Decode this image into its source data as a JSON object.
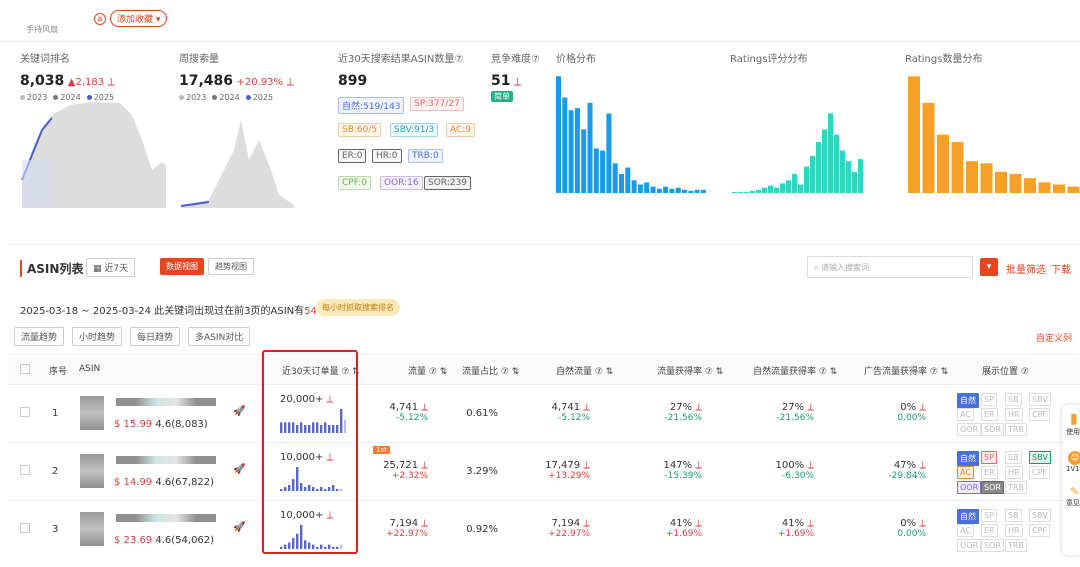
{
  "header": {
    "subtitle": "手持风扇",
    "fav_label": "添加收藏 ▾"
  },
  "metrics": {
    "kw_rank": {
      "title": "关键词排名",
      "value": "8,038",
      "delta": "▲2,183"
    },
    "weekly": {
      "title": "周搜索量",
      "value": "17,486",
      "delta": "+20.93%"
    },
    "asin30": {
      "title": "近30天搜索结果ASIN数量⑦",
      "value": "899"
    },
    "comp": {
      "title": "竞争难度⑦",
      "value": "51",
      "badge": "简单"
    },
    "price": {
      "title": "价格分布"
    },
    "rating": {
      "title": "Ratings评分分布"
    },
    "rcount": {
      "title": "Ratings数量分布"
    },
    "years": [
      "2023",
      "2024",
      "2025"
    ]
  },
  "asin_tags": [
    {
      "t": "自然:519/143",
      "c": "#4a6fd8",
      "bg": "#eef2ff"
    },
    {
      "t": "SP:377/27",
      "c": "#e26a6a",
      "bg": "#fff2f2"
    },
    {
      "t": "SB:60/5",
      "c": "#e08a2e",
      "bg": "#fff7ee"
    },
    {
      "t": "SBV:91/3",
      "c": "#2a9fb0",
      "bg": "#eefafc"
    },
    {
      "t": "AC:9",
      "c": "#e08a2e",
      "bg": "#fff7ee"
    },
    {
      "t": "ER:0",
      "c": "#666",
      "bg": "#f6f6f6"
    },
    {
      "t": "HR:0",
      "c": "#666",
      "bg": "#f6f6f6"
    },
    {
      "t": "TRB:0",
      "c": "#4a6fd8",
      "bg": "#eef2ff"
    },
    {
      "t": "CPF:0",
      "c": "#6aa84f",
      "bg": "#f2fbee"
    },
    {
      "t": "OOR:16",
      "c": "#8a6ad8",
      "bg": "#f5f1ff"
    },
    {
      "t": "SOR:239",
      "c": "#666",
      "bg": "#f3f3f3"
    }
  ],
  "asin_list": {
    "title": "ASIN列表",
    "range_btn": "近7天",
    "view_data": "数据视图",
    "view_trend": "趋势视图",
    "search_placeholder": "请输入搜索词",
    "batch": "批量筛选",
    "download": "下载",
    "date_text": "2025-03-18 ~ 2025-03-24   此关键词出现过在前3页的ASIN有",
    "count": "540",
    "count_unit": "个",
    "hourly": "每小时抓取搜索排名",
    "btns": [
      "流量趋势",
      "小时趋势",
      "每日趋势",
      "多ASIN对比"
    ],
    "custom": "自定义列"
  },
  "columns": [
    "序号",
    "ASIN",
    "近30天订单量 ⑦ ⇅",
    "流量 ⑦ ⇅",
    "流量占比 ⑦ ⇅",
    "自然流量 ⑦ ⇅",
    "流量获得率 ⑦ ⇅",
    "自然流量获得率 ⑦ ⇅",
    "广告流量获得率 ⑦ ⇅",
    "展示位置 ⑦"
  ],
  "rows": [
    {
      "idx": "1",
      "price": "$ 15.99",
      "rating": "4.6(8,083)",
      "orders": "20,000+",
      "traffic": "4,741",
      "traffic_d": "-5.12%",
      "share": "0.61%",
      "nat": "4,741",
      "nat_d": "-5.12%",
      "rate": "27%",
      "rate_d": "-21.56%",
      "nrate": "27%",
      "nrate_d": "-21.56%",
      "arate": "0%",
      "arate_d": "0.00%"
    },
    {
      "idx": "2",
      "price": "$ 14.99",
      "rating": "4.6(67,822)",
      "orders": "10,000+",
      "traffic": "25,721",
      "traffic_d": "+2.32%",
      "share": "3.29%",
      "nat": "17,479",
      "nat_d": "+13.29%",
      "rate": "147%",
      "rate_d": "-15.39%",
      "nrate": "100%",
      "nrate_d": "-6.30%",
      "arate": "47%",
      "arate_d": "-29.84%",
      "first": "1st"
    },
    {
      "idx": "3",
      "price": "$ 23.69",
      "rating": "4.6(54,062)",
      "orders": "10,000+",
      "traffic": "7,194",
      "traffic_d": "+22.97%",
      "share": "0.92%",
      "nat": "7,194",
      "nat_d": "+22.97%",
      "rate": "41%",
      "rate_d": "+1.69%",
      "nrate": "41%",
      "nrate_d": "+1.69%",
      "arate": "0%",
      "arate_d": "0.00%"
    }
  ],
  "positions": [
    "自然",
    "SP",
    "SB",
    "SBV",
    "AC",
    "ER",
    "HR",
    "CPF",
    "OOR",
    "SOR",
    "TRB"
  ],
  "side": [
    "使用",
    "1V1",
    "意见"
  ]
}
